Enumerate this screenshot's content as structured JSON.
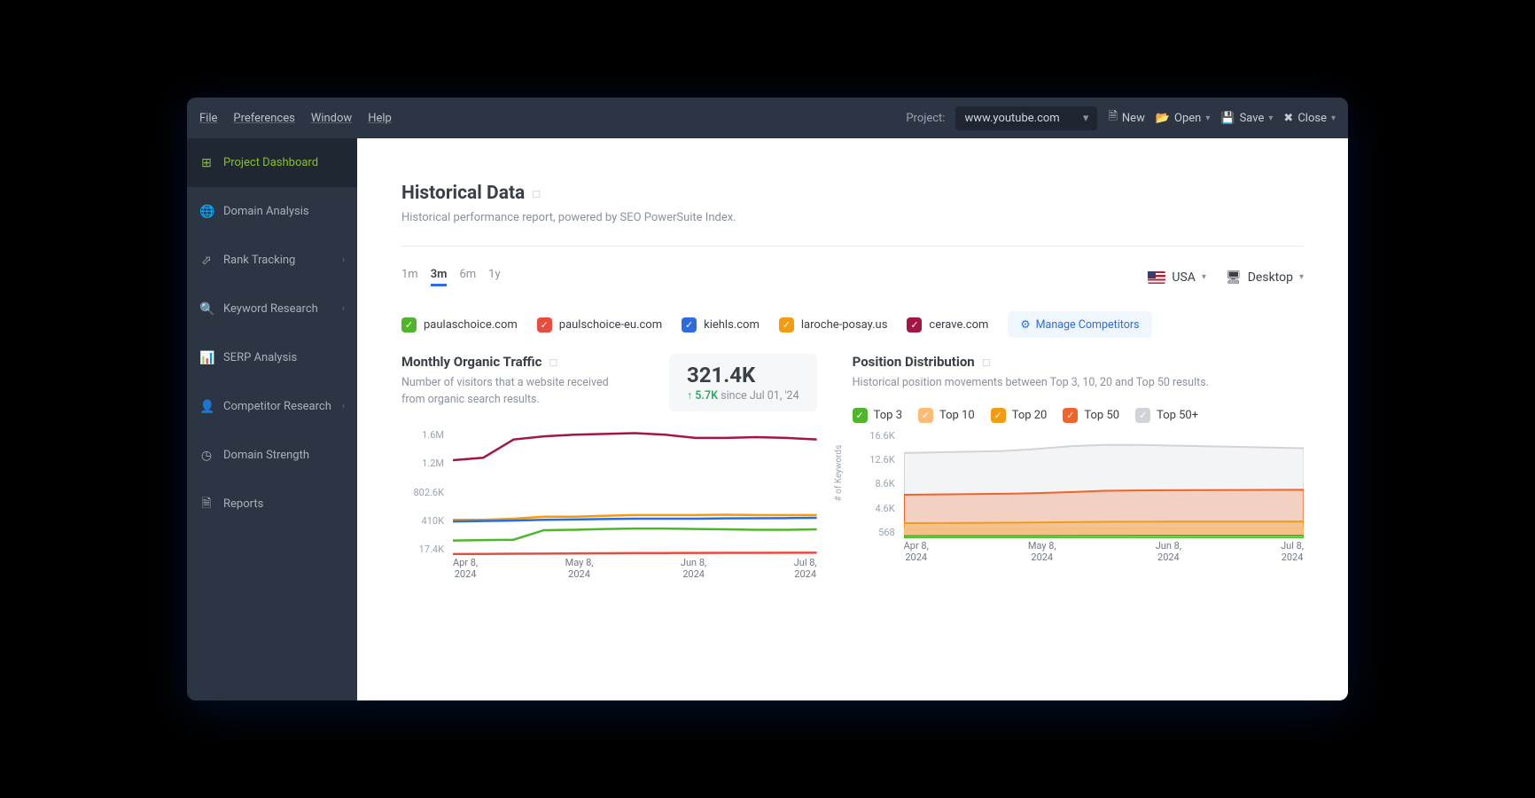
{
  "menubar": {
    "items": [
      "File",
      "Preferences",
      "Window",
      "Help"
    ]
  },
  "project": {
    "label": "Project:",
    "value": "www.youtube.com"
  },
  "toolbar": {
    "new": "New",
    "open": "Open",
    "save": "Save",
    "close": "Close"
  },
  "sidebar": {
    "items": [
      {
        "label": "Project Dashboard",
        "icon": "grid",
        "active": true
      },
      {
        "label": "Domain Analysis",
        "icon": "globe"
      },
      {
        "label": "Rank Tracking",
        "icon": "chart",
        "chev": true
      },
      {
        "label": "Keyword Research",
        "icon": "search",
        "chev": true
      },
      {
        "label": "SERP Analysis",
        "icon": "bars"
      },
      {
        "label": "Competitor Research",
        "icon": "person",
        "chev": true
      },
      {
        "label": "Domain Strength",
        "icon": "gauge"
      },
      {
        "label": "Reports",
        "icon": "doc"
      }
    ]
  },
  "page": {
    "title": "Historical Data",
    "subtitle": "Historical performance report, powered by SEO PowerSuite Index."
  },
  "ranges": [
    "1m",
    "3m",
    "6m",
    "1y"
  ],
  "range_selected": "3m",
  "region": {
    "label": "USA"
  },
  "device": {
    "label": "Desktop"
  },
  "competitors": [
    {
      "name": "paulaschoice.com",
      "color": "gre"
    },
    {
      "name": "paulschoice-eu.com",
      "color": "red"
    },
    {
      "name": "kiehls.com",
      "color": "blu"
    },
    {
      "name": "laroche-posay.us",
      "color": "ora"
    },
    {
      "name": "cerave.com",
      "color": "mar"
    }
  ],
  "manage_competitors_label": "Manage Competitors",
  "traffic": {
    "title": "Monthly Organic Traffic",
    "subtitle": "Number of visitors that a website received from organic search results.",
    "stat_value": "321.4K",
    "stat_delta": "↑ 5.7K",
    "stat_since": "since Jul 01, '24"
  },
  "position": {
    "title": "Position Distribution",
    "subtitle": "Historical position movements between Top 3, 10, 20 and Top 50 results.",
    "legend": [
      "Top 3",
      "Top 10",
      "Top 20",
      "Top 50",
      "Top 50+"
    ],
    "yaxis_label": "# of Keywords"
  },
  "chart_data": [
    {
      "type": "line",
      "title": "Monthly Organic Traffic",
      "xlabel": "",
      "ylabel": "",
      "x": [
        "Apr 8, 2024",
        "May 8, 2024",
        "Jun 8, 2024",
        "Jul 8, 2024"
      ],
      "y_ticks": [
        "1.6M",
        "1.2M",
        "802.6K",
        "410K",
        "17.4K"
      ],
      "ylim": [
        17400,
        1600000
      ],
      "series": [
        {
          "name": "cerave.com",
          "color": "#a31545",
          "values": [
            1210000,
            1240000,
            1470000,
            1510000,
            1530000,
            1540000,
            1550000,
            1530000,
            1490000,
            1490000,
            1500000,
            1490000,
            1470000
          ]
        },
        {
          "name": "laroche-posay.us",
          "color": "#f39c12",
          "values": [
            460000,
            460000,
            475000,
            500000,
            500000,
            510000,
            520000,
            520000,
            520000,
            525000,
            520000,
            520000,
            520000
          ]
        },
        {
          "name": "kiehls.com",
          "color": "#2d6cdf",
          "values": [
            440000,
            445000,
            450000,
            460000,
            465000,
            470000,
            475000,
            475000,
            475000,
            478000,
            480000,
            482000,
            485000
          ]
        },
        {
          "name": "paulaschoice.com",
          "color": "#4fb52a",
          "values": [
            200000,
            205000,
            210000,
            330000,
            335000,
            345000,
            350000,
            350000,
            345000,
            340000,
            335000,
            335000,
            340000
          ]
        },
        {
          "name": "paulschoice-eu.com",
          "color": "#e74c3c",
          "values": [
            30000,
            32000,
            34000,
            36000,
            38000,
            40000,
            42000,
            43000,
            44000,
            45000,
            45000,
            46000,
            46000
          ]
        }
      ]
    },
    {
      "type": "area",
      "title": "Position Distribution",
      "xlabel": "",
      "ylabel": "# of Keywords",
      "x": [
        "Apr 8, 2024",
        "May 8, 2024",
        "Jun 8, 2024",
        "Jul 8, 2024"
      ],
      "y_ticks": [
        "16.6K",
        "12.6K",
        "8.6K",
        "4.6K",
        "568"
      ],
      "ylim": [
        568,
        16600
      ],
      "series": [
        {
          "name": "Top 50+",
          "color": "#d0d4d9",
          "values": [
            13200,
            13300,
            13400,
            13500,
            13800,
            14200,
            14400,
            14400,
            14300,
            14200,
            14100,
            14000,
            13900
          ]
        },
        {
          "name": "Top 50",
          "color": "#f0632a",
          "values": [
            7000,
            7050,
            7100,
            7150,
            7250,
            7400,
            7600,
            7650,
            7680,
            7700,
            7720,
            7730,
            7740
          ]
        },
        {
          "name": "Top 20",
          "color": "#f39c12",
          "values": [
            2800,
            2820,
            2840,
            2860,
            2900,
            2950,
            3000,
            3020,
            3030,
            3040,
            3040,
            3040,
            3050
          ]
        },
        {
          "name": "Top 10",
          "color": "#fdbb74",
          "values": [
            1900,
            1910,
            1920,
            1930,
            1950,
            1980,
            2010,
            2020,
            2025,
            2030,
            2030,
            2030,
            2035
          ]
        },
        {
          "name": "Top 3",
          "color": "#4fb52a",
          "values": [
            900,
            905,
            908,
            910,
            920,
            935,
            950,
            955,
            958,
            960,
            960,
            960,
            962
          ]
        }
      ]
    }
  ]
}
